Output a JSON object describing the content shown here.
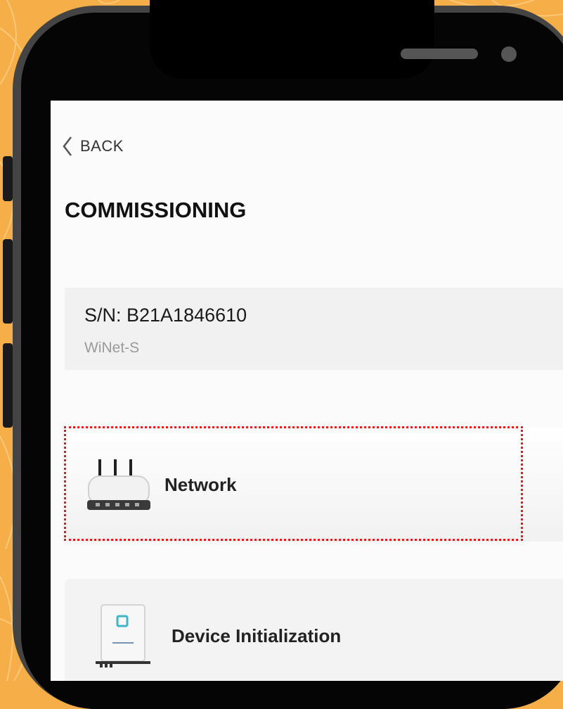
{
  "screen": {
    "back_label": "BACK",
    "title": "COMMISSIONING",
    "device": {
      "serial": "S/N: B21A1846610",
      "model": "WiNet-S"
    },
    "menu": [
      {
        "label": "Network",
        "icon": "router-icon"
      },
      {
        "label": "Device Initialization",
        "icon": "inverter-icon"
      }
    ]
  },
  "colors": {
    "background": "#f6ae48",
    "phone_frame": "#444444",
    "highlight_border": "#e31b1b"
  }
}
